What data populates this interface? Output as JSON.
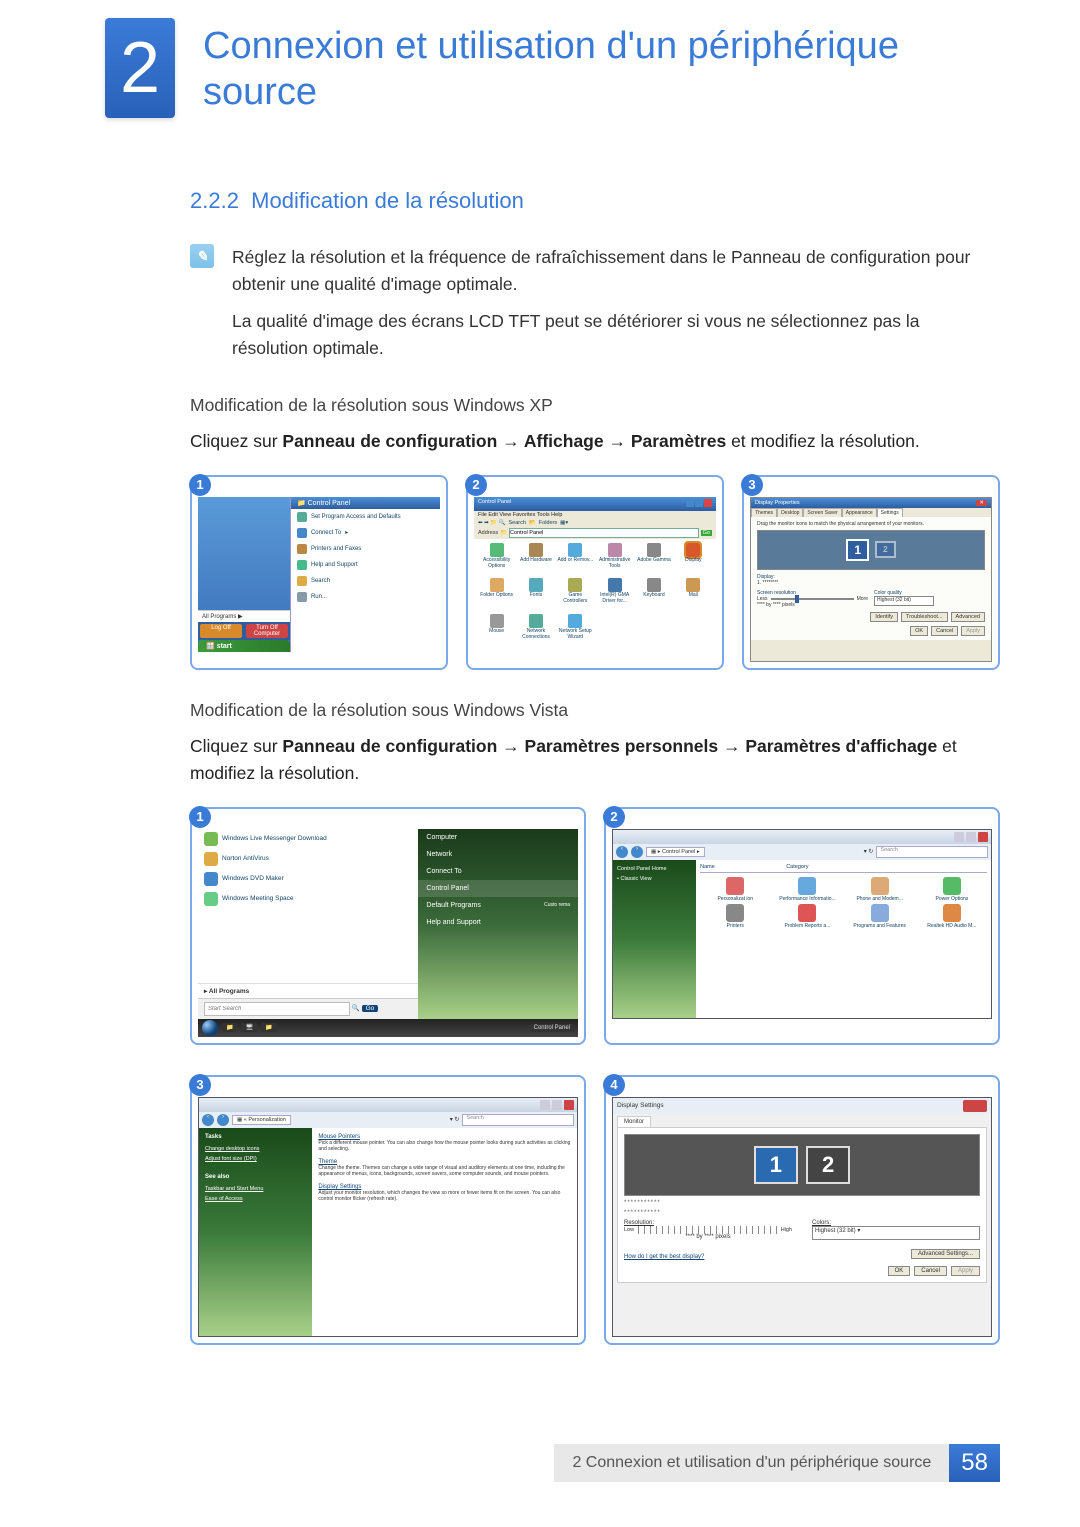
{
  "chapter": {
    "number": "2",
    "title": "Connexion et utilisation d'un périphérique source"
  },
  "section": {
    "number": "2.2.2",
    "title": "Modification de la résolution"
  },
  "info": {
    "p1": "Réglez la résolution et la fréquence de rafraîchissement dans le Panneau de configuration pour obtenir une qualité d'image optimale.",
    "p2": "La qualité d'image des écrans LCD TFT peut se détériorer si vous ne sélectionnez pas la résolution optimale."
  },
  "xp": {
    "heading": "Modification de la résolution sous Windows XP",
    "intro_pre": "Cliquez sur ",
    "b1": "Panneau de configuration",
    "arrow": " → ",
    "b2": "Affichage",
    "b3": "Paramètres",
    "intro_post": " et modifiez la résolution.",
    "step1": {
      "badge": "1",
      "cp_title": "Control Panel",
      "items": [
        "Set Program Access and Defaults",
        "Connect To",
        "Printers and Faxes",
        "Help and Support",
        "Search",
        "Run..."
      ],
      "all_programs": "All Programs",
      "logoff": "Log Off",
      "turnoff": "Turn Off Computer",
      "start": "start"
    },
    "step2": {
      "badge": "2",
      "title": "Control Panel",
      "menu": "File   Edit   View   Favorites   Tools   Help",
      "search": "Search",
      "folders": "Folders",
      "address_label": "Address",
      "address_value": "Control Panel",
      "go": "Go",
      "icons": [
        "Accessibility Options",
        "Add Hardware",
        "Add or Remov...",
        "Administrative Tools",
        "Adobe Gamma",
        "Display",
        "Folder Options",
        "Fonts",
        "Game Controllers",
        "Intel(R) GMA Driver for...",
        "Keyboard",
        "Mail",
        "Mouse",
        "Network Connections",
        "Network Setup Wizard"
      ]
    },
    "step3": {
      "badge": "3",
      "title": "Display Properties",
      "tabs": [
        "Themes",
        "Desktop",
        "Screen Saver",
        "Appearance",
        "Settings"
      ],
      "hint": "Drag the monitor icons to match the physical arrangement of your monitors.",
      "mon1": "1",
      "mon2": "2",
      "display_label": "Display:",
      "display_value": "1. ********",
      "res_label": "Screen resolution",
      "less": "Less",
      "more": "More",
      "res_value": "**** by **** pixels",
      "color_label": "Color quality",
      "color_value": "Highest (32 bit)",
      "identify": "Identify",
      "troubleshoot": "Troubleshoot...",
      "advanced": "Advanced",
      "ok": "OK",
      "cancel": "Cancel",
      "apply": "Apply"
    }
  },
  "vista": {
    "heading": "Modification de la résolution sous Windows Vista",
    "intro_pre": "Cliquez sur ",
    "b1": "Panneau de configuration",
    "arrow": " → ",
    "b2": "Paramètres personnels",
    "b3": "Paramètres d'affichage",
    "intro_post": " et modifiez la résolution.",
    "step1": {
      "badge": "1",
      "left_items": [
        "Windows Live Messenger Download",
        "Norton AntiVirus",
        "Windows DVD Maker",
        "Windows Meeting Space"
      ],
      "all_programs": "All Programs",
      "search_placeholder": "Start Search",
      "go": "Go",
      "right_items": [
        "Computer",
        "Network",
        "Connect To",
        "Control Panel",
        "Default Programs",
        "Help and Support"
      ],
      "task_btn": "Control Panel",
      "custo": "Custo rema"
    },
    "step2": {
      "badge": "2",
      "crumb": "Control Panel",
      "search": "Search",
      "side_home": "Control Panel Home",
      "side_classic": "Classic View",
      "col_name": "Name",
      "col_cat": "Category",
      "icons": [
        "Personalizat ion",
        "Performance Informatio...",
        "Phone and Modem...",
        "Power Options",
        "Printers",
        "Problem Reports a...",
        "Programs and Features",
        "Realtek HD Audio M..."
      ]
    },
    "step3": {
      "badge": "3",
      "crumb": "Personalization",
      "search": "Search",
      "tasks": "Tasks",
      "task_links": [
        "Change desktop icons",
        "Adjust font size (DPI)"
      ],
      "see_also": "See also",
      "see_links": [
        "Taskbar and Start Menu",
        "Ease of Access"
      ],
      "sec_mouse_h": "Mouse Pointers",
      "sec_mouse_d": "Pick a different mouse pointer. You can also change how the mouse pointer looks during such activities as clicking and selecting.",
      "sec_theme_h": "Theme",
      "sec_theme_d": "Change the theme. Themes can change a wide range of visual and auditory elements at one time, including the appearance of menus, icons, backgrounds, screen savers, some computer sounds, and mouse pointers.",
      "sec_disp_h": "Display Settings",
      "sec_disp_d": "Adjust your monitor resolution, which changes the view so more or fewer items fit on the screen. You can also control monitor flicker (refresh rate)."
    },
    "step4": {
      "badge": "4",
      "title": "Display Settings",
      "tab": "Monitor",
      "mon1": "1",
      "mon2": "2",
      "dots": "***********",
      "res_label": "Resolution:",
      "low": "Low",
      "high": "High",
      "res_value": "**** by **** pixels",
      "color_label": "Colors:",
      "color_value": "Highest (32 bit)",
      "link": "How do I get the best display?",
      "advanced": "Advanced Settings...",
      "ok": "OK",
      "cancel": "Cancel",
      "apply": "Apply"
    }
  },
  "footer": {
    "text": "2 Connexion et utilisation d'un périphérique source",
    "page": "58"
  }
}
